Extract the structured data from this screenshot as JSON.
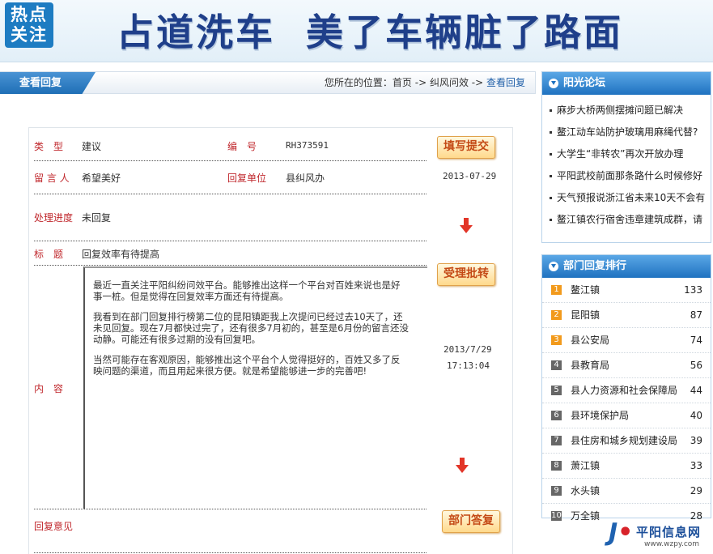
{
  "banner": {
    "badge": [
      "热点",
      "关注"
    ],
    "title": "占道洗车  美了车辆脏了路面"
  },
  "location": {
    "tab": "查看回复",
    "prefix": "您所在的位置：",
    "home": "首页",
    "sep1": " -> ",
    "section": "纠风问效",
    "sep2": " -> ",
    "current": "查看回复"
  },
  "detail": {
    "type_label": "类　型",
    "type_value": "建议",
    "id_label": "编　号",
    "id_value": "RH373591",
    "author_label": "留 言 人",
    "author_value": "希望美好",
    "unit_label": "回复单位",
    "unit_value": "县纠风办",
    "progress_label": "处理进度",
    "progress_value": "未回复",
    "title_label": "标　题",
    "title_value": "回复效率有待提高",
    "content_label": "内　容",
    "content_paragraphs": [
      "最近一直关注平阳纠纷问效平台。能够推出这样一个平台对百姓来说也是好事一桩。但是觉得在回复效率方面还有待提高。",
      "我看到在部门回复排行榜第二位的昆阳镇距我上次提问已经过去10天了，还未见回复。现在7月都快过完了，还有很多7月初的，甚至是6月份的留言还没动静。可能还有很多过期的没有回复吧。",
      "当然可能存在客观原因，能够推出这个平台个人觉得挺好的，百姓又多了反映问题的渠道，而且用起来很方便。就是希望能够进一步的完善吧!"
    ],
    "reply_label": "回复意见"
  },
  "workflow": {
    "submit_button": "填写提交",
    "submit_date": "2013-07-29",
    "accept_button": "受理批转",
    "accept_date": "2013/7/29",
    "accept_time": "17:13:04",
    "answer_button": "部门答复"
  },
  "sidebar": {
    "forum_title": "阳光论坛",
    "forum_items": [
      "麻步大桥两侧摆摊问题已解决",
      "鳌江动车站防护玻璃用麻绳代替?",
      "大学生“非转农”再次开放办理",
      "平阳武校前面那条路什么时候修好",
      "天气预报说浙江省未来10天不会有",
      "鳌江镇农行宿舍违章建筑成群，请"
    ],
    "ranking_title": "部门回复排行",
    "ranking": [
      {
        "rank": "1",
        "name": "鳌江镇",
        "count": "133"
      },
      {
        "rank": "2",
        "name": "昆阳镇",
        "count": "87"
      },
      {
        "rank": "3",
        "name": "县公安局",
        "count": "74"
      },
      {
        "rank": "4",
        "name": "县教育局",
        "count": "56"
      },
      {
        "rank": "5",
        "name": "县人力资源和社会保障局",
        "count": "44"
      },
      {
        "rank": "6",
        "name": "县环境保护局",
        "count": "40"
      },
      {
        "rank": "7",
        "name": "县住房和城乡规划建设局",
        "count": "39"
      },
      {
        "rank": "8",
        "name": "萧江镇",
        "count": "33"
      },
      {
        "rank": "9",
        "name": "水头镇",
        "count": "29"
      },
      {
        "rank": "10",
        "name": "万全镇",
        "count": "28"
      }
    ]
  },
  "footer_logo": {
    "name": "平阳信息网",
    "url": "www.wzpy.com"
  }
}
